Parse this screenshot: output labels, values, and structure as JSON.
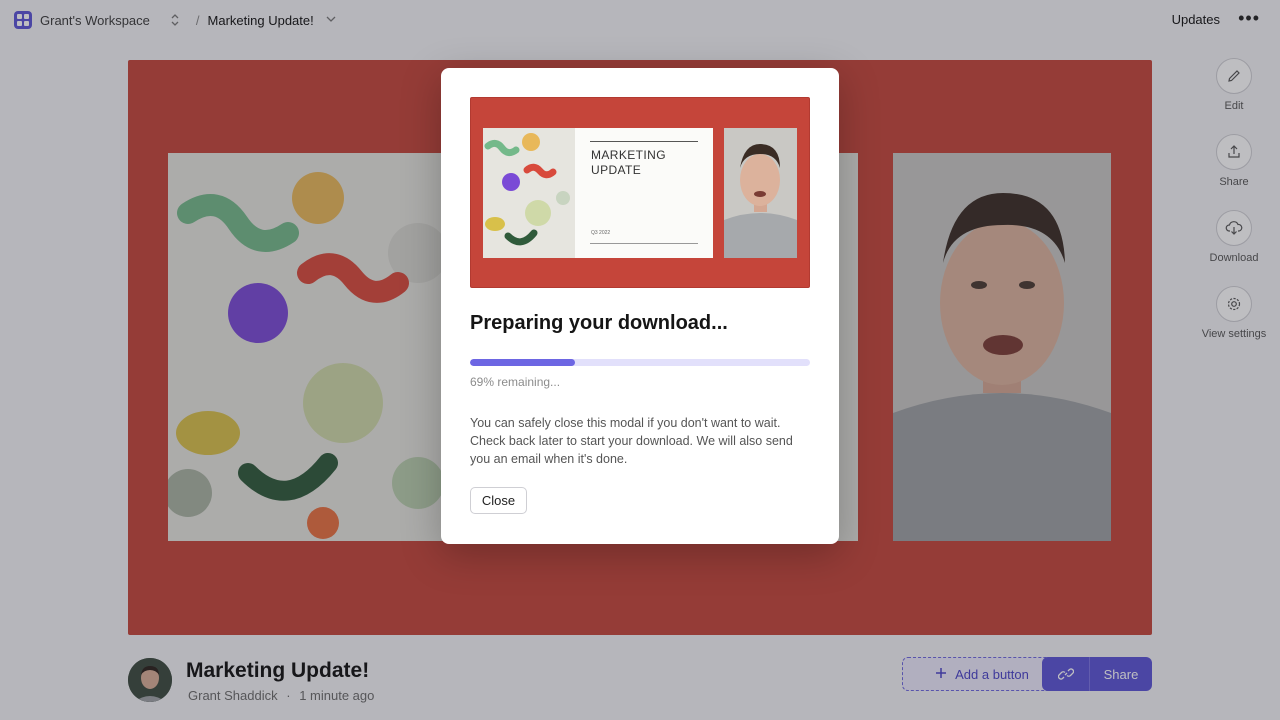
{
  "topbar": {
    "workspace_name": "Grant's Workspace",
    "separator": "/",
    "doc_name": "Marketing Update!",
    "updates_label": "Updates",
    "more_label": "•••"
  },
  "rail": {
    "items": [
      {
        "label": "Edit",
        "icon": "pencil-icon"
      },
      {
        "label": "Share",
        "icon": "upload-icon"
      },
      {
        "label": "Download",
        "icon": "cloud-download-icon"
      },
      {
        "label": "View settings",
        "icon": "gear-icon"
      }
    ]
  },
  "footer": {
    "title": "Marketing Update!",
    "author": "Grant Shaddick",
    "dot": "·",
    "time": "1 minute ago",
    "add_button_label": "Add a button",
    "share_label": "Share"
  },
  "modal": {
    "preview": {
      "slide_title_line1": "MARKETING",
      "slide_title_line2": "UPDATE",
      "slide_date": "Q3 2022"
    },
    "title": "Preparing your download...",
    "progress_fraction": 0.31,
    "progress_text": "69% remaining...",
    "body": "You can safely close this modal if you don't want to wait. Check back later to start your download. We will also send you an email when it's done.",
    "close_label": "Close"
  },
  "colors": {
    "accent": "#5b53d6",
    "stage": "#c5453a"
  }
}
